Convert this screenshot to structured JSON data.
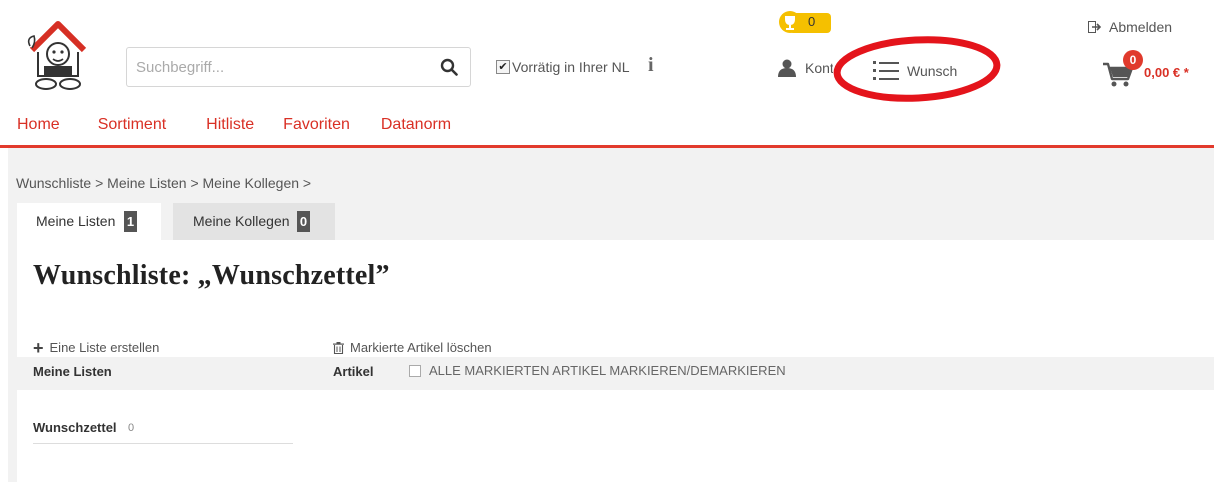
{
  "header": {
    "search_placeholder": "Suchbegriff...",
    "stock_label": "Vorrätig in Ihrer NL",
    "stock_checked": true,
    "info_glyph": "i",
    "trophy_count": "0",
    "konto_label": "Konto",
    "wunsch_label": "Wunsch",
    "logout_label": "Abmelden",
    "cart_count": "0",
    "cart_total": "0,00 € *"
  },
  "colors": {
    "brand_red": "#e23a2c",
    "trophy_yellow": "#f5c000",
    "annotation_red": "#e4141b"
  },
  "nav": [
    "Home",
    "Sortiment",
    "Hitliste",
    "Favoriten",
    "Datanorm"
  ],
  "breadcrumb": "Wunschliste > Meine Listen > Meine Kollegen >",
  "tabs": [
    {
      "label": "Meine Listen",
      "count": "1",
      "active": true
    },
    {
      "label": "Meine Kollegen",
      "count": "0",
      "active": false
    }
  ],
  "page_title": "Wunschliste: „Wunschzettel”",
  "actions": {
    "create_list": "Eine Liste erstellen",
    "delete_marked": "Markierte Artikel löschen"
  },
  "columns": {
    "lists": "Meine Listen",
    "articles": "Artikel",
    "select_all": "ALLE MARKIERTEN ARTIKEL MARKIEREN/DEMARKIEREN"
  },
  "lists": [
    {
      "name": "Wunschzettel",
      "count": "0"
    }
  ],
  "icons": [
    "mascot-logo",
    "search-icon",
    "info-icon",
    "trophy-icon",
    "user-icon",
    "list-icon",
    "logout-icon",
    "cart-icon",
    "plus-icon",
    "trash-icon"
  ]
}
